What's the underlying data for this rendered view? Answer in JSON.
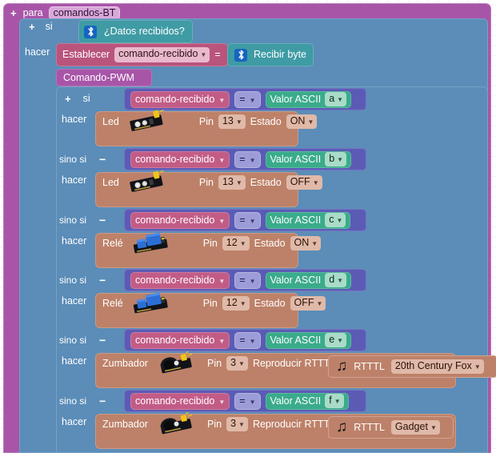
{
  "canvas": {
    "background": "#ffffff",
    "grid": "cross-dot-grid"
  },
  "colors": {
    "procedure": "#a855a8",
    "control": "#5b8db8",
    "variable": "#b9547d",
    "bluetooth": "#3f9ba4",
    "logic": "#5b5bb5",
    "text": "#3aab8b",
    "device": "#bd8169"
  },
  "procedure": {
    "expand_icon": "+",
    "keyword": "para",
    "name": "comandos-BT"
  },
  "outer_if": {
    "expand_icon": "+",
    "if_label": "si",
    "do_label": "hacer",
    "condition": {
      "icon": "bluetooth-icon",
      "label": "¿Datos recibidos?"
    }
  },
  "set_statement": {
    "keyword": "Establecer",
    "variable": "comando-recibido",
    "operator": "=",
    "value": {
      "icon": "bluetooth-icon",
      "label": "Recibir byte"
    }
  },
  "call_statement": {
    "label": "Comando-PWM"
  },
  "inner_if": {
    "expand_icon": "+",
    "collapse_icon": "−",
    "if_label": "si",
    "elseif_label": "sino si",
    "do_label": "hacer",
    "operator": "=",
    "variable": "comando-recibido",
    "ascii_label": "Valor ASCII",
    "branches": [
      {
        "kind": "if",
        "ascii_value": "a",
        "action": {
          "device": "Led",
          "icon": "led-module-icon",
          "pin_label": "Pin",
          "pin": "13",
          "state_label": "Estado",
          "state": "ON"
        }
      },
      {
        "kind": "elseif",
        "ascii_value": "b",
        "action": {
          "device": "Led",
          "icon": "led-module-icon",
          "pin_label": "Pin",
          "pin": "13",
          "state_label": "Estado",
          "state": "OFF"
        }
      },
      {
        "kind": "elseif",
        "ascii_value": "c",
        "action": {
          "device": "Relé",
          "icon": "relay-module-icon",
          "pin_label": "Pin",
          "pin": "12",
          "state_label": "Estado",
          "state": "ON"
        }
      },
      {
        "kind": "elseif",
        "ascii_value": "d",
        "action": {
          "device": "Relé",
          "icon": "relay-module-icon",
          "pin_label": "Pin",
          "pin": "12",
          "state_label": "Estado",
          "state": "OFF"
        }
      },
      {
        "kind": "elseif",
        "ascii_value": "e",
        "action": {
          "device": "Zumbador",
          "icon": "buzzer-module-icon",
          "pin_label": "Pin",
          "pin": "3",
          "play_label": "Reproducir RTTTL",
          "rtttl_icon": "music-note-icon",
          "rtttl_label": "RTTTL",
          "rtttl_value": "20th Century Fox"
        }
      },
      {
        "kind": "elseif",
        "ascii_value": "f",
        "action": {
          "device": "Zumbador",
          "icon": "buzzer-module-icon",
          "pin_label": "Pin",
          "pin": "3",
          "play_label": "Reproducir RTTTL",
          "rtttl_icon": "music-note-icon",
          "rtttl_label": "RTTTL",
          "rtttl_value": "Gadget"
        }
      }
    ]
  }
}
